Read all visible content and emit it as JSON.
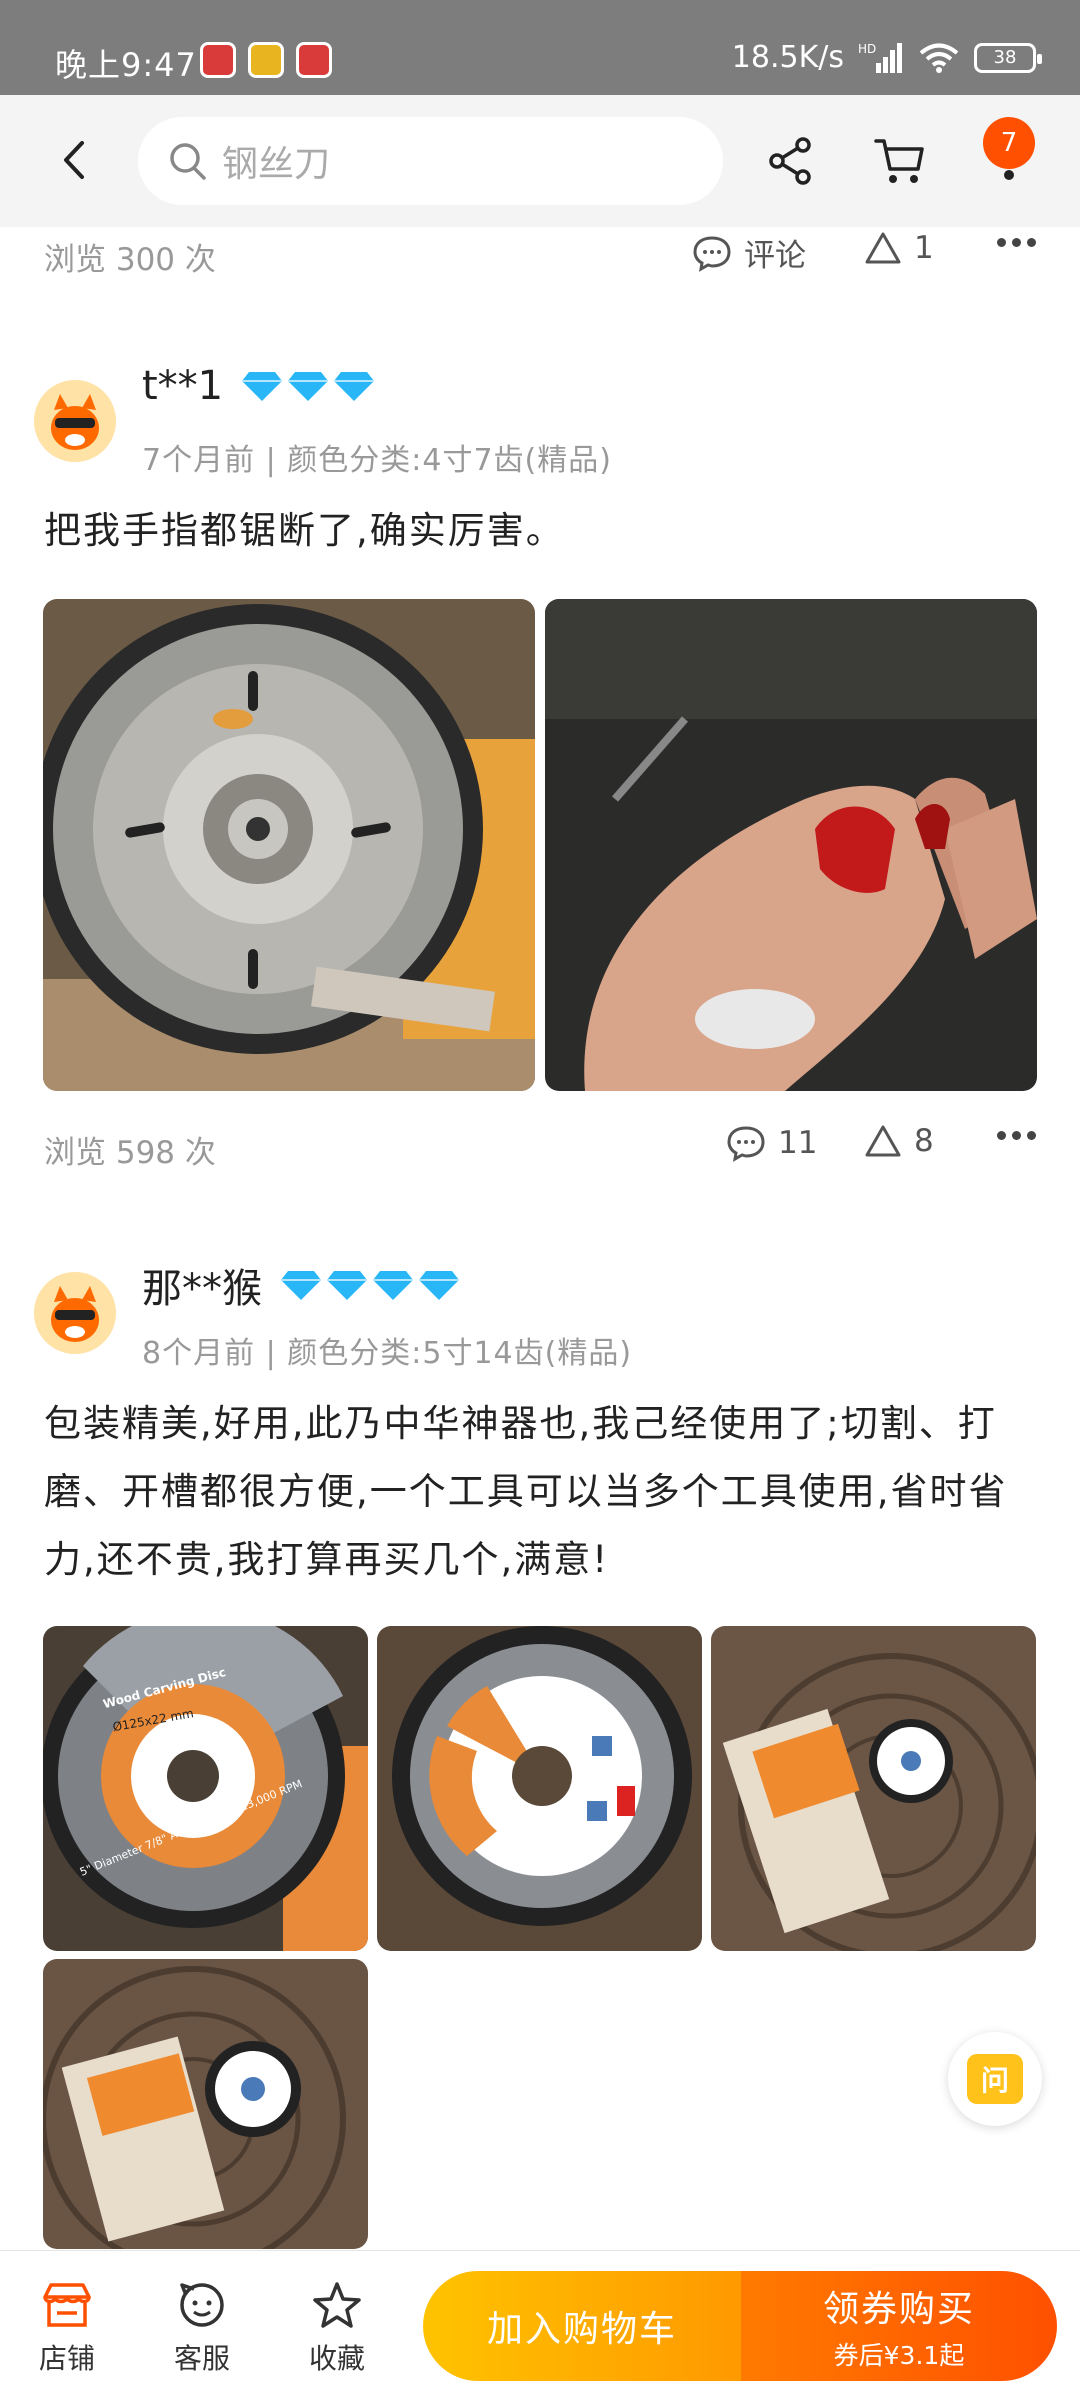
{
  "status_bar": {
    "time": "晚上9:47",
    "network_speed": "18.5K/s",
    "network_badge": "HD",
    "battery": "38"
  },
  "header": {
    "search_placeholder": "钢丝刀",
    "cart_badge": "7"
  },
  "prev_review_footer": {
    "views": "浏览 300 次",
    "comment_label": "评论",
    "like_count": "1"
  },
  "reviews": [
    {
      "username": "t**1",
      "diamond_level": 3,
      "meta": "7个月前 | 颜色分类:4寸7齿(精品)",
      "text": "把我手指都锯断了,确实厉害。",
      "photos": [
        "saw-disc-photo",
        "injured-finger-photo"
      ],
      "views": "浏览 598 次",
      "comment_count": "11",
      "like_count": "8"
    },
    {
      "username": "那**猴",
      "diamond_level": 4,
      "meta": "8个月前 | 颜色分类:5寸14齿(精品)",
      "text": "包装精美,好用,此乃中华神器也,我己经使用了;切割、打磨、开槽都很方便,一个工具可以当多个工具使用,省时省力,还不贵,我打算再买几个,满意!",
      "photos": [
        "disc-label-photo-1",
        "disc-label-photo-2",
        "package-on-wood-photo-1",
        "package-on-wood-photo-2"
      ]
    }
  ],
  "disc_label": {
    "brand": "Wood Carving Disc",
    "size": "Ø125x22 mm",
    "spec": "5\" Diameter 7/8\" Arbor 10,000-13,000 RPM"
  },
  "float_button": {
    "label": "问"
  },
  "bottom_bar": {
    "shop": "店铺",
    "service": "客服",
    "favorite": "收藏",
    "add_to_cart": "加入购物车",
    "buy_title": "领券购买",
    "buy_sub": "券后¥3.1起"
  },
  "colors": {
    "accent_orange": "#ff5000",
    "accent_yellow": "#ffc300",
    "diamond_blue": "#29b6f6"
  }
}
